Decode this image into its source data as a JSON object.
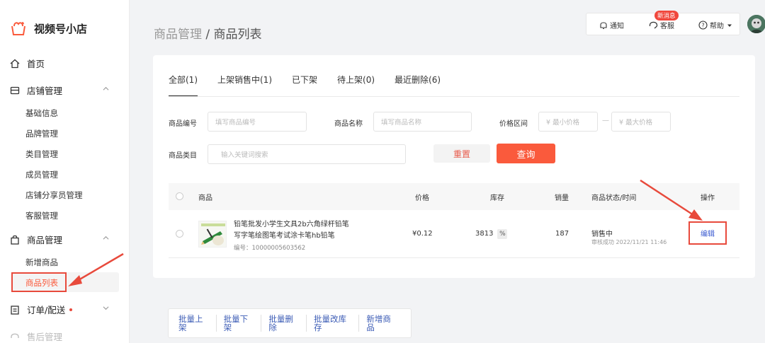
{
  "app": {
    "name": "视频号小店"
  },
  "sidebar": {
    "home": "首页",
    "shop": {
      "label": "店铺管理",
      "items": [
        "基础信息",
        "品牌管理",
        "类目管理",
        "成员管理",
        "店铺分享员管理",
        "客服管理"
      ]
    },
    "goods": {
      "label": "商品管理",
      "items": [
        "新增商品",
        "商品列表"
      ]
    },
    "orders": "订单/配送",
    "aftersale": "售后管理"
  },
  "header": {
    "breadcrumb_parent": "商品管理",
    "separator": " / ",
    "breadcrumb_current": "商品列表",
    "notify": "通知",
    "service": "客服",
    "new_msg_badge": "新消息",
    "help": "帮助"
  },
  "tabs": [
    "全部(1)",
    "上架销售中(1)",
    "已下架",
    "待上架(0)",
    "最近删除(6)"
  ],
  "filters": {
    "code_label": "商品编号",
    "code_placeholder": "填写商品编号",
    "name_label": "商品名称",
    "name_placeholder": "填写商品名称",
    "price_label": "价格区间",
    "price_min": "¥  最小价格",
    "price_max": "¥  最大价格",
    "price_dash": "—",
    "category_label": "商品类目",
    "category_placeholder": "输入关键词搜索",
    "reset": "重置",
    "search": "查询"
  },
  "table": {
    "headers": {
      "product": "商品",
      "price": "价格",
      "stock": "库存",
      "sales": "销量",
      "status": "商品状态/时间",
      "action": "操作"
    },
    "rows": [
      {
        "name": "铅笔批发小学生文具2b六角绿杆铅笔写字笔绘图笔考试涂卡笔hb铅笔",
        "code": "编号：10000005603562",
        "price": "¥0.12",
        "stock": "3813",
        "stock_icon": "%",
        "sales": "187",
        "status": "销售中",
        "status_time": "审核成功 2022/11/21 11:46",
        "action": "编辑"
      }
    ]
  },
  "bulk": [
    "批量上架",
    "批量下架",
    "批量删除",
    "批量改库存",
    "新增商品"
  ],
  "colors": {
    "accent": "#fa5a3c",
    "annotation": "#e84a3c",
    "link": "#3a5ad0"
  }
}
